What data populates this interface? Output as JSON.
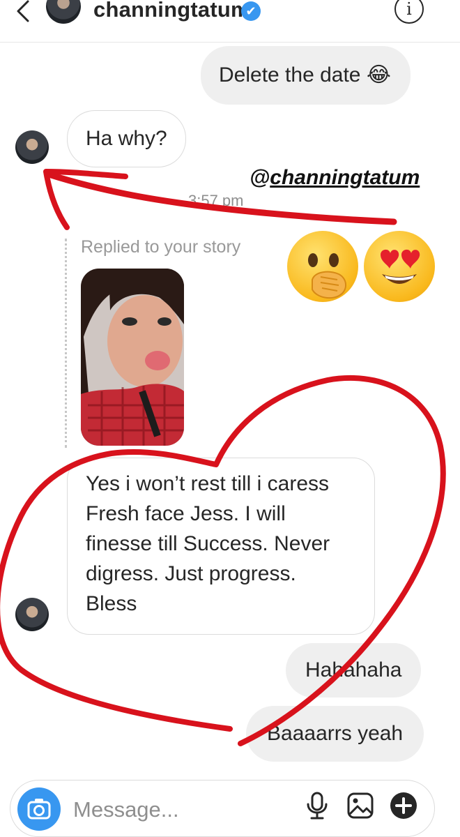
{
  "header": {
    "username": "channingtatum",
    "verified_symbol": "✔",
    "info_symbol": "i",
    "back_icon": "chevron-left-icon"
  },
  "thread": {
    "messages": [
      {
        "from": "me",
        "text": "Delete the date 😂"
      },
      {
        "from": "them",
        "text": "Ha why?"
      },
      {
        "from": "them",
        "lines": [
          "Yes i won’t rest till i caress",
          "Fresh face Jess. I will",
          "finesse till Success. Never",
          "digress. Just progress.",
          "Bless"
        ]
      },
      {
        "from": "me",
        "text": "Hahahaha"
      },
      {
        "from": "me",
        "text": "Baaaarrs yeah"
      }
    ],
    "timestamp": "3:57 pm",
    "story_reply_label": "Replied to your story",
    "reactions": [
      "hand-over-mouth-emoji",
      "heart-eyes-emoji"
    ]
  },
  "annotations": {
    "mention": "@channingtatum",
    "arrow_color": "#d8121c"
  },
  "composer": {
    "placeholder": "Message...",
    "icons": [
      "camera-icon",
      "microphone-icon",
      "gallery-icon",
      "add-icon"
    ]
  },
  "colors": {
    "accent": "#3897f0",
    "sent_bubble": "#efefef",
    "received_border": "#dbdbdb",
    "annotation_red": "#d8121c"
  }
}
